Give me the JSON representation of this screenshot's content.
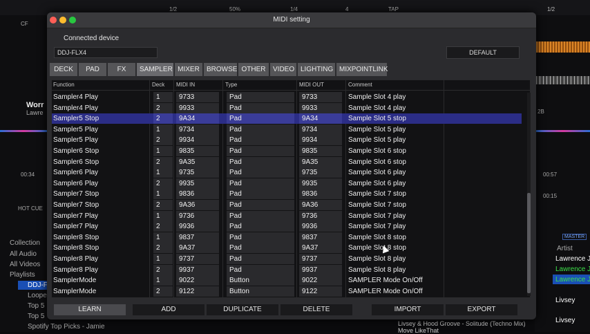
{
  "background_app": {
    "top_labels": [
      "1/2",
      "50%",
      "1/4",
      "4",
      "TAP",
      "1/2"
    ],
    "left_labels": [
      "CF",
      "Worr",
      "Lawre",
      "00:34",
      "HOT CUE",
      "Collection",
      "All Audio",
      "All Videos",
      "Playlists",
      "DDJ-F",
      "Loope",
      "Top 5",
      "Top 5",
      "Spotify Top Picks - Jamie"
    ],
    "right_labels": [
      "2B",
      "00:57",
      "00:15",
      "MASTER",
      "Artist",
      "Lawrence J",
      "Lawrence J",
      "Lawrence J",
      "Livsey",
      "Livsey"
    ],
    "bottom_labels": [
      "Livsey & Hood Groove - Solitude (Techno Mix)",
      "Move LikeThat"
    ]
  },
  "dialog": {
    "title": "MIDI setting",
    "connected_device_label": "Connected device",
    "device_value": "DDJ-FLX4",
    "default_button": "DEFAULT",
    "tabs": [
      "DECK",
      "PAD",
      "FX",
      "SAMPLER",
      "MIXER",
      "BROWSE",
      "OTHER",
      "VIDEO",
      "LIGHTING",
      "MIXPOINTLINK"
    ],
    "active_tab": "SAMPLER",
    "columns": [
      "Function",
      "Deck",
      "MIDI IN",
      "Type",
      "MIDI OUT",
      "Comment"
    ],
    "rows": [
      {
        "function": "Sampler4 Play",
        "deck": "1",
        "midi_in": "9733",
        "type": "Pad",
        "midi_out": "9733",
        "comment": "Sample Slot 4 play"
      },
      {
        "function": "Sampler4 Play",
        "deck": "2",
        "midi_in": "9933",
        "type": "Pad",
        "midi_out": "9933",
        "comment": "Sample Slot 4 play"
      },
      {
        "function": "Sampler5 Stop",
        "deck": "2",
        "midi_in": "9A34",
        "type": "Pad",
        "midi_out": "9A34",
        "comment": "Sample Slot 5 stop"
      },
      {
        "function": "Sampler5 Play",
        "deck": "1",
        "midi_in": "9734",
        "type": "Pad",
        "midi_out": "9734",
        "comment": "Sample Slot 5 play"
      },
      {
        "function": "Sampler5 Play",
        "deck": "2",
        "midi_in": "9934",
        "type": "Pad",
        "midi_out": "9934",
        "comment": "Sample Slot 5 play"
      },
      {
        "function": "Sampler6 Stop",
        "deck": "1",
        "midi_in": "9835",
        "type": "Pad",
        "midi_out": "9835",
        "comment": "Sample Slot 6 stop"
      },
      {
        "function": "Sampler6 Stop",
        "deck": "2",
        "midi_in": "9A35",
        "type": "Pad",
        "midi_out": "9A35",
        "comment": "Sample Slot 6 stop"
      },
      {
        "function": "Sampler6 Play",
        "deck": "1",
        "midi_in": "9735",
        "type": "Pad",
        "midi_out": "9735",
        "comment": "Sample Slot 6 play"
      },
      {
        "function": "Sampler6 Play",
        "deck": "2",
        "midi_in": "9935",
        "type": "Pad",
        "midi_out": "9935",
        "comment": "Sample Slot 6 play"
      },
      {
        "function": "Sampler7 Stop",
        "deck": "1",
        "midi_in": "9836",
        "type": "Pad",
        "midi_out": "9836",
        "comment": "Sample Slot 7 stop"
      },
      {
        "function": "Sampler7 Stop",
        "deck": "2",
        "midi_in": "9A36",
        "type": "Pad",
        "midi_out": "9A36",
        "comment": "Sample Slot 7 stop"
      },
      {
        "function": "Sampler7 Play",
        "deck": "1",
        "midi_in": "9736",
        "type": "Pad",
        "midi_out": "9736",
        "comment": "Sample Slot 7 play"
      },
      {
        "function": "Sampler7 Play",
        "deck": "2",
        "midi_in": "9936",
        "type": "Pad",
        "midi_out": "9936",
        "comment": "Sample Slot 7 play"
      },
      {
        "function": "Sampler8 Stop",
        "deck": "1",
        "midi_in": "9837",
        "type": "Pad",
        "midi_out": "9837",
        "comment": "Sample Slot 8 stop"
      },
      {
        "function": "Sampler8 Stop",
        "deck": "2",
        "midi_in": "9A37",
        "type": "Pad",
        "midi_out": "9A37",
        "comment": "Sample Slot 8 stop"
      },
      {
        "function": "Sampler8 Play",
        "deck": "1",
        "midi_in": "9737",
        "type": "Pad",
        "midi_out": "9737",
        "comment": "Sample Slot 8 play"
      },
      {
        "function": "Sampler8 Play",
        "deck": "2",
        "midi_in": "9937",
        "type": "Pad",
        "midi_out": "9937",
        "comment": "Sample Slot 8 play"
      },
      {
        "function": "SamplerMode",
        "deck": "1",
        "midi_in": "9022",
        "type": "Button",
        "midi_out": "9022",
        "comment": "SAMPLER Mode On/Off"
      },
      {
        "function": "SamplerMode",
        "deck": "2",
        "midi_in": "9122",
        "type": "Button",
        "midi_out": "9122",
        "comment": "SAMPLER Mode On/Off"
      }
    ],
    "selected_row": 2,
    "bottom_buttons": [
      "LEARN",
      "ADD",
      "DUPLICATE",
      "DELETE",
      "IMPORT",
      "EXPORT"
    ]
  },
  "colors": {
    "selected_row": "#2b2d86",
    "window_close": "#ff5f57",
    "window_minimize": "#febc2e",
    "window_maximize": "#28c840"
  }
}
